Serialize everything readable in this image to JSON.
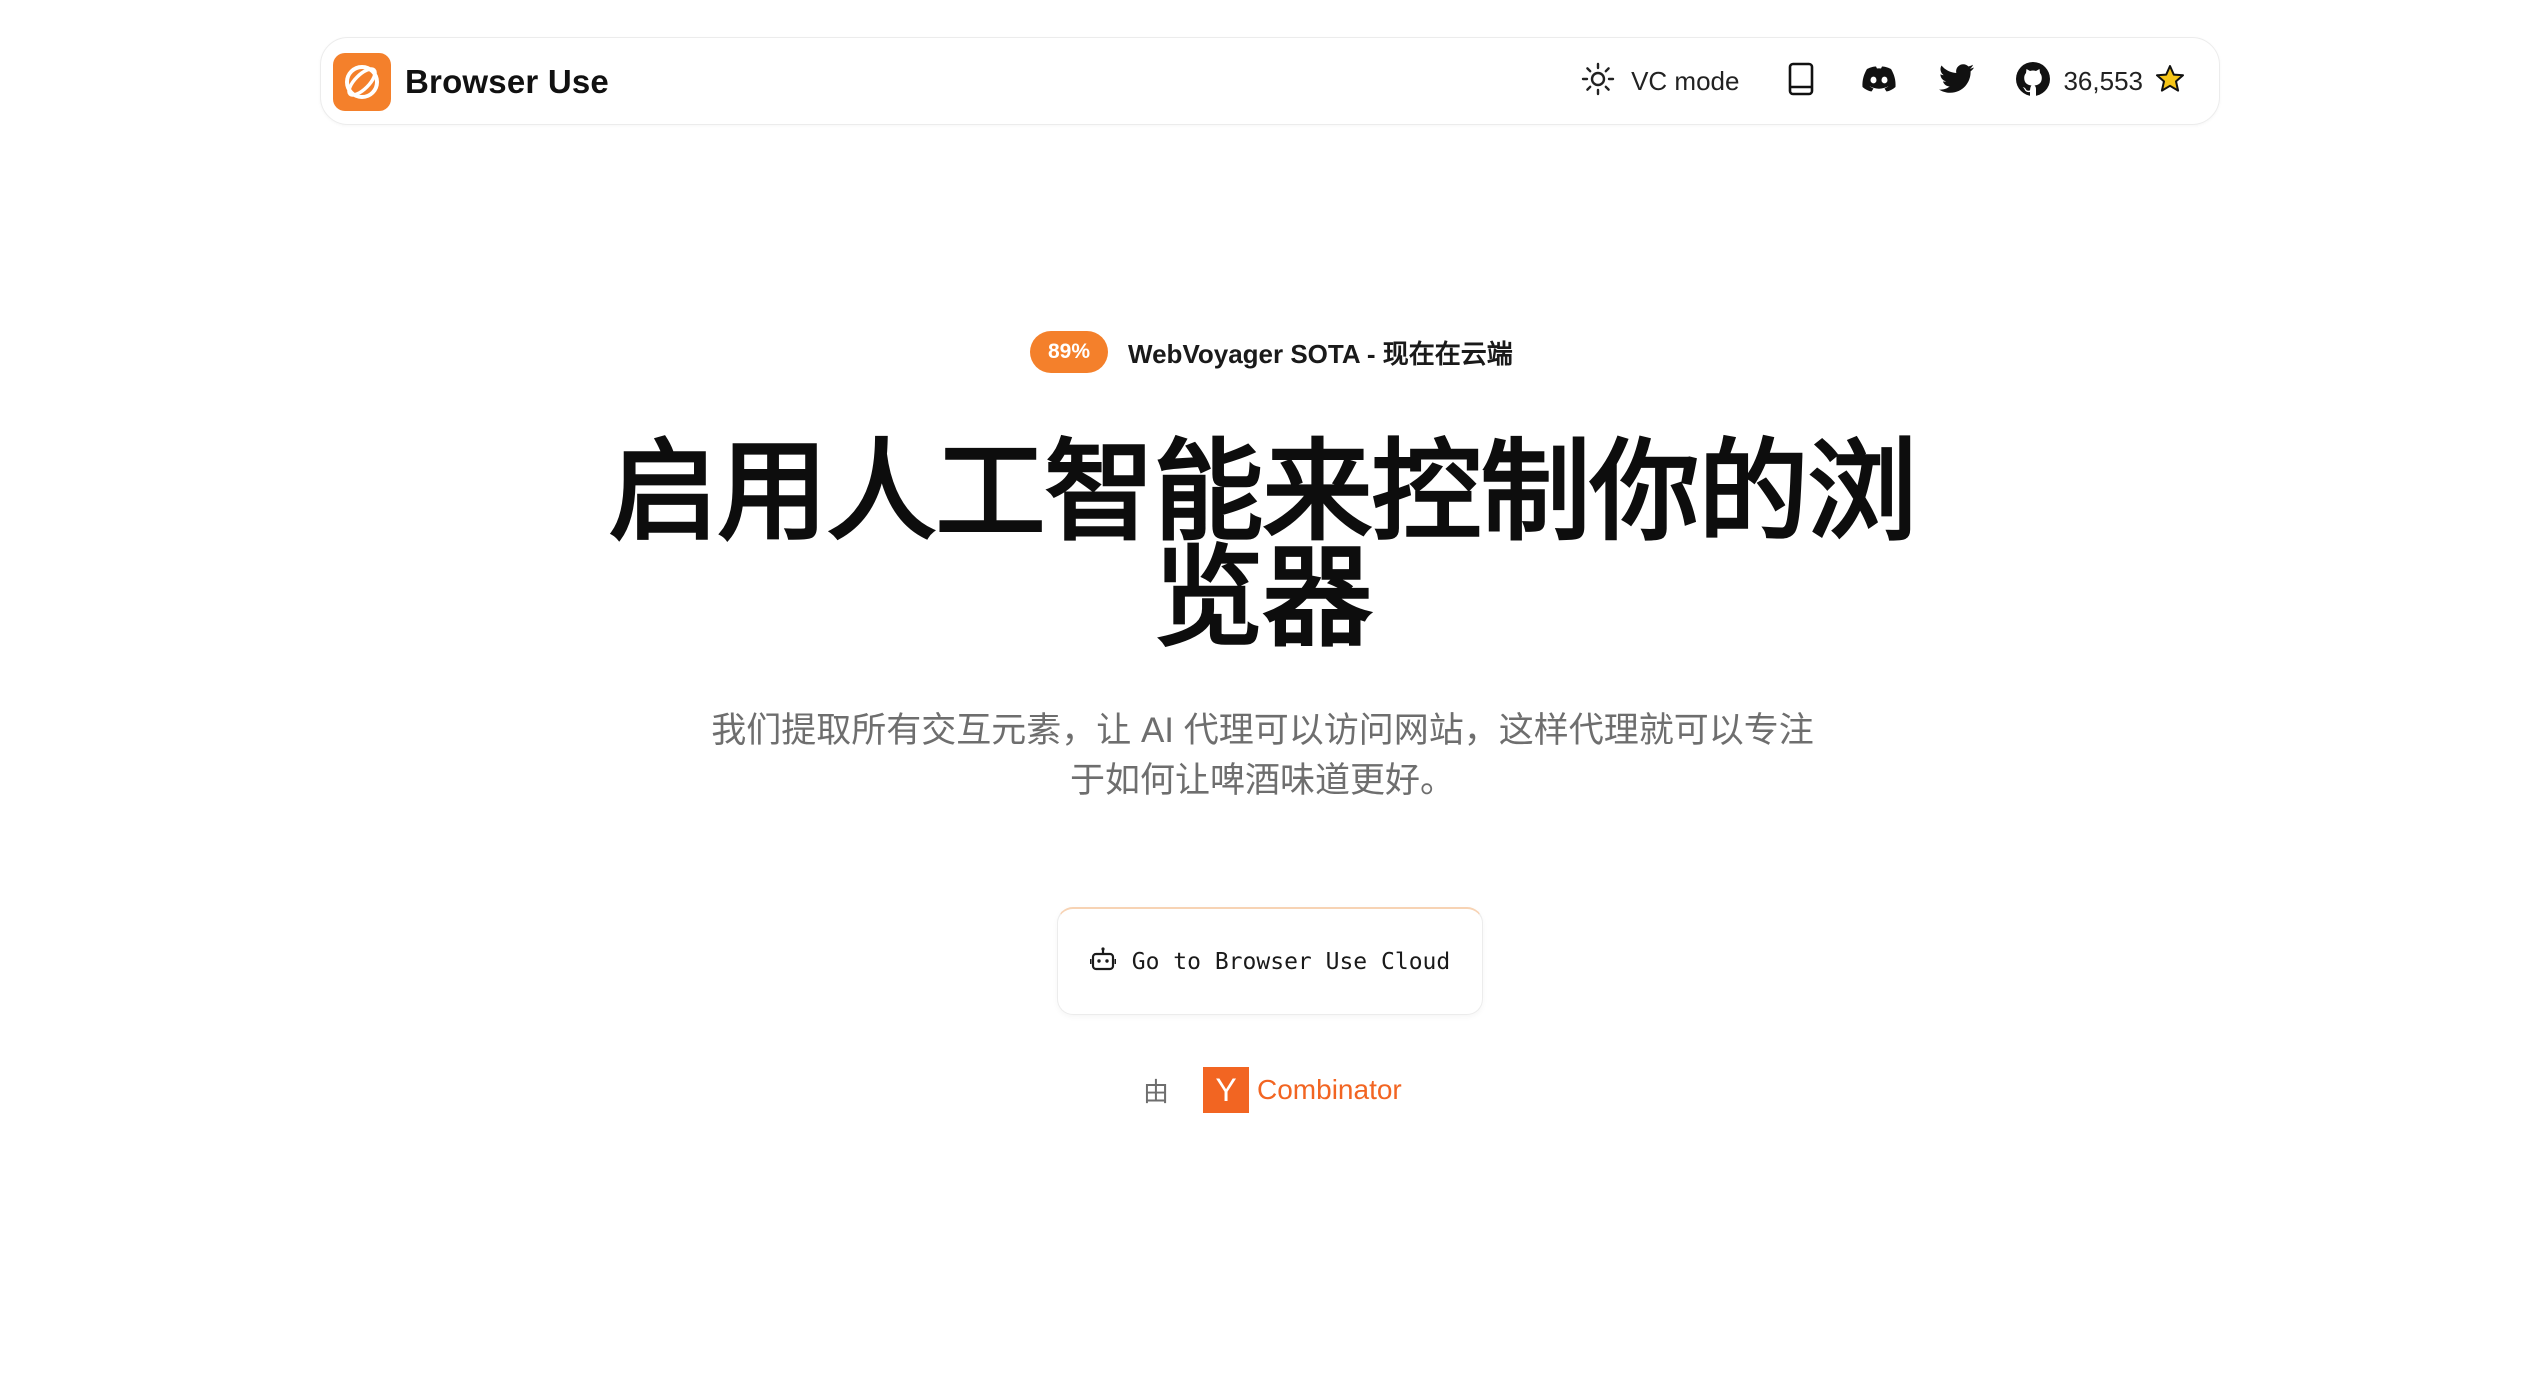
{
  "header": {
    "brand_name": "Browser Use",
    "vc_mode_label": "VC mode",
    "icons": [
      "sun-icon",
      "book-icon",
      "discord-icon",
      "twitter-icon",
      "github-icon",
      "star-icon"
    ],
    "github_stars": "36,553",
    "star_glyph": "☆"
  },
  "announcement": {
    "badge": "89%",
    "text": "WebVoyager SOTA - 现在在云端"
  },
  "hero": {
    "title": "启用人工智能来控制你的浏览器",
    "subtitle": "我们提取所有交互元素，让 AI 代理可以访问网站，这样代理就可以专注于如何让啤酒味道更好。",
    "cta_label": "Go to Browser Use Cloud",
    "cta_icon": "bot-icon"
  },
  "backing": {
    "prefix": "由",
    "yc_letter": "Y",
    "yc_name": "Combinator"
  },
  "colors": {
    "accent": "#f4802b",
    "yc_orange": "#f26522",
    "text": "#111111",
    "muted": "#6e6e6e"
  }
}
